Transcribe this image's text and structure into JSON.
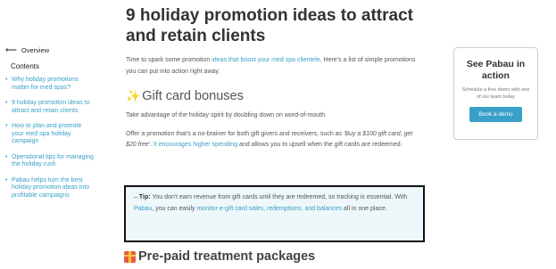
{
  "sidebar": {
    "back_label": "Overview",
    "contents_title": "Contents",
    "items": [
      {
        "label": "Why holiday promotions matter for med spas?"
      },
      {
        "label": "9 holiday promotion ideas to attract and retain clients"
      },
      {
        "label": "How to plan and promote your med spa holiday campaign"
      },
      {
        "label": "Operational tips for managing the holiday rush"
      },
      {
        "label": "Pabau helps turn the best holiday promotion ideas into profitable campaigns"
      }
    ]
  },
  "article": {
    "title": "9 holiday promotion ideas to attract and retain clients",
    "intro_before": "Time to spark some promotion ",
    "intro_link": "ideas that boost your med spa clientele",
    "intro_after": ". Here's a list of simple promotions you can put into action right away.",
    "section1_icon": "✨",
    "section1_heading": "Gift card bonuses",
    "section1_p1": "Take advantage of the holiday spirit by doubling down on word-of-mouth.",
    "section1_p2_a": "Offer a promotion that's a no-brainer for both gift givers and receivers, such as ",
    "section1_p2_em": "'Buy a $100 gift card, get $20 free'",
    "section1_p2_b": ". ",
    "section1_p2_link": "It encourages higher spending",
    "section1_p2_c": " and allows you to upsell when the gift cards are redeemed.",
    "tip_prefix": "– ",
    "tip_label": "Tip:",
    "tip_text_a": " You don't earn revenue from gift cards until they are redeemed, so tracking is essential. With ",
    "tip_link1": "Pabau",
    "tip_text_b": ", you can easily ",
    "tip_link2": "monitor e-gift card sales, redemptions, and balances",
    "tip_text_c": " all in one place.",
    "section2_heading": "Pre-paid treatment packages"
  },
  "demo_card": {
    "title": "See Pabau in action",
    "subtitle": "Schedule a free demo with one of our team today",
    "button_label": "Book a demo"
  },
  "colors": {
    "link": "#3aa0c8",
    "tip_border": "#111111",
    "tip_background": "#eef7fa",
    "button": "#3aa0c8"
  }
}
